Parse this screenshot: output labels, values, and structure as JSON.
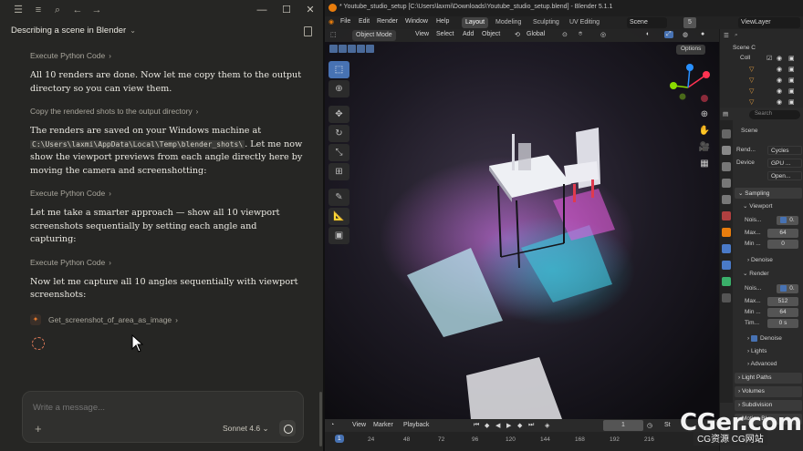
{
  "chat": {
    "title": "Describing a scene in Blender",
    "blocks": [
      {
        "kind": "tool",
        "text": "Execute Python Code"
      },
      {
        "kind": "para",
        "text": "All 10 renders are done. Now let me copy them to the output directory so you can view them."
      },
      {
        "kind": "tool",
        "text": "Copy the rendered shots to the output directory"
      },
      {
        "kind": "para_code",
        "before": "The renders are saved on your Windows machine at ",
        "code": "C:\\Users\\laxmi\\AppData\\Local\\Temp\\blender_shots\\",
        "after": ". Let me now show the viewport previews from each angle directly here by moving the camera and screenshotting:"
      },
      {
        "kind": "tool",
        "text": "Execute Python Code"
      },
      {
        "kind": "para",
        "text": "Let me take a smarter approach — show all 10 viewport screenshots sequentially by setting each angle and capturing:"
      },
      {
        "kind": "tool",
        "text": "Execute Python Code"
      },
      {
        "kind": "para",
        "text": "Now let me capture all 10 angles sequentially with viewport screenshots:"
      }
    ],
    "tool_call": "Get_screenshot_of_area_as_image",
    "composer": {
      "placeholder": "Write a message...",
      "model": "Sonnet 4.6"
    }
  },
  "blender": {
    "window_title": "* Youtube_studio_setup [C:\\Users\\laxmi\\Downloads\\Youtube_studio_setup.blend] - Blender 5.1.1",
    "menu": [
      "File",
      "Edit",
      "Render",
      "Window",
      "Help"
    ],
    "workspaces": [
      "Layout",
      "Modeling",
      "Sculpting",
      "UV Editing"
    ],
    "active_workspace": "Layout",
    "scene": "Scene",
    "scene_count": "5",
    "view_layer": "ViewLayer",
    "viewport_header": {
      "mode": "Object Mode",
      "items": [
        "View",
        "Select",
        "Add",
        "Object"
      ],
      "orientation": "Global"
    },
    "options_label": "Options",
    "timeline": {
      "items": [
        "View",
        "Marker",
        "Playback"
      ],
      "current_frame": "1",
      "frame_ticks": [
        "1",
        "24",
        "48",
        "72",
        "96",
        "120",
        "144",
        "168",
        "192",
        "216"
      ],
      "partial_label": "St"
    },
    "outliner": {
      "rows": [
        "Scene C",
        "Coll"
      ]
    },
    "properties": {
      "search_placeholder": "Search",
      "scene_name": "Scene",
      "render_engine_label": "Rend...",
      "render_engine": "Cycles",
      "device_label": "Device",
      "device": "GPU ...",
      "open_label": "Open...",
      "sampling": "Sampling",
      "viewport": "Viewport",
      "noise_label": "Nois...",
      "noise_val": "0.",
      "max_label": "Max...",
      "viewport_max": "64",
      "min_label": "Min ...",
      "viewport_min": "0",
      "denoise": "Denoise",
      "render": "Render",
      "render_noise": "0.",
      "render_max": "512",
      "render_min": "64",
      "time_label": "Tim...",
      "time_val": "0 s",
      "denoise2": "Denoise",
      "lights": "Lights",
      "advanced": "Advanced",
      "light_paths": "Light Paths",
      "volumes": "Volumes",
      "subdivision": "Subdivision",
      "motion_blur": "Motion Bl"
    }
  },
  "watermark": {
    "main": "CGer.com",
    "sub": "CG资源 CG网站"
  }
}
